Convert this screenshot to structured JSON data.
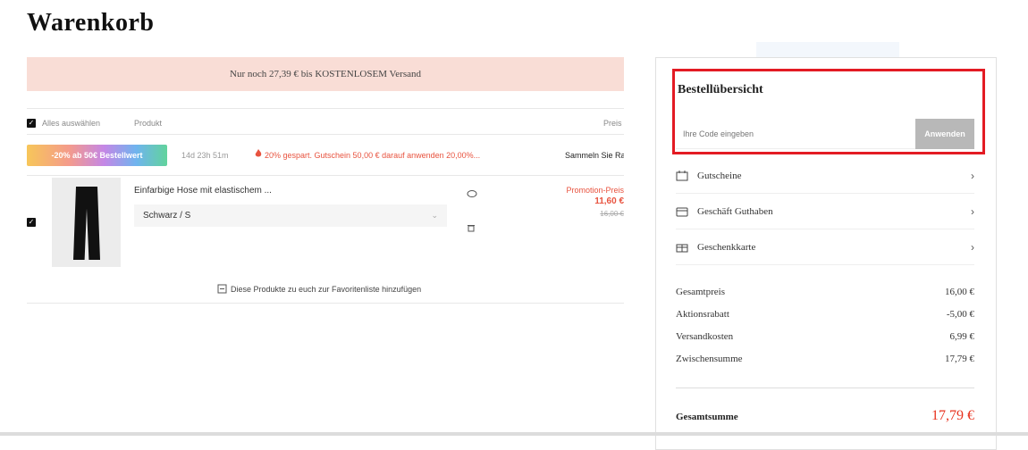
{
  "page": {
    "title": "Warenkorb"
  },
  "cart": {
    "shipping_banner": "Nur noch 27,39 € bis KOSTENLOSEM Versand",
    "header": {
      "select_all": "Alles auswählen",
      "product": "Produkt",
      "price": "Preis"
    },
    "promo": {
      "badge": "-20% ab 50€ Bestellwert",
      "timer": "14d 23h 51m",
      "message": "20% gespart. Gutschein 50,00 € darauf anwenden 20,00%...",
      "collect_more": "Sammeln Sie Rabatt"
    },
    "item": {
      "name": "Einfarbige Hose mit elastischem ...",
      "size": "Schwarz / S",
      "price_label": "Promotion-Preis",
      "price": "11,60 €",
      "old_price": "16,00 €"
    },
    "move_to_favorites": "Diese Produkte zu euch zur Favoritenliste hinzufügen"
  },
  "summary": {
    "title": "Bestellübersicht",
    "code_placeholder": "Ihre Code eingeben",
    "apply_label": "Anwenden",
    "options": [
      {
        "label": "Gutscheine",
        "icon": "coupon-icon"
      },
      {
        "label": "Geschäft Guthaben",
        "icon": "wallet-icon"
      },
      {
        "label": "Geschenkkarte",
        "icon": "gift-icon"
      }
    ],
    "rows": [
      {
        "label": "Gesamtpreis",
        "value": "16,00 €"
      },
      {
        "label": "Aktionsrabatt",
        "value": "-5,00 €"
      },
      {
        "label": "Versandkosten",
        "value": "6,99 €"
      },
      {
        "label": "Zwischensumme",
        "value": "17,79 €"
      }
    ],
    "total": {
      "label": "Gesamtsumme",
      "value": "17,79 €"
    }
  },
  "colors": {
    "highlight": "#e31b23",
    "price_red": "#e8331f",
    "banner_bg": "#f9ddd6"
  }
}
